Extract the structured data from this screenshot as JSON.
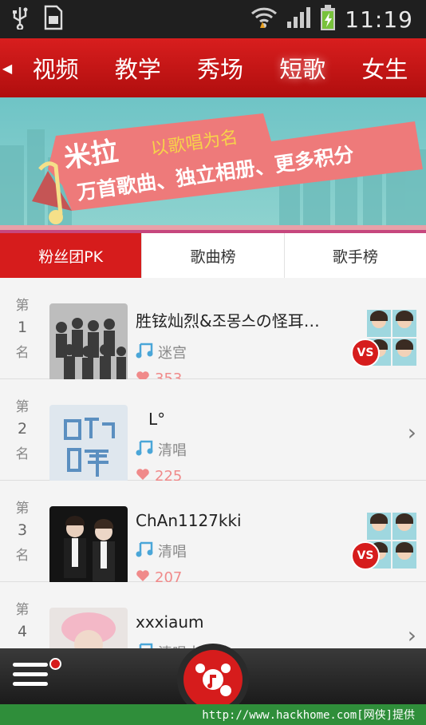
{
  "status_bar": {
    "time": "11:19"
  },
  "top_nav": {
    "tabs": [
      {
        "label": "视频"
      },
      {
        "label": "教学"
      },
      {
        "label": "秀场"
      },
      {
        "label": "短歌",
        "active": true
      },
      {
        "label": "女生"
      }
    ]
  },
  "banner": {
    "brand": "米拉",
    "tagline": "以歌唱为名",
    "slogan": "万首歌曲、独立相册、更多积分"
  },
  "segment_tabs": [
    {
      "label": "粉丝团PK",
      "active": true
    },
    {
      "label": "歌曲榜"
    },
    {
      "label": "歌手榜"
    }
  ],
  "rank_labels": {
    "prefix": "第",
    "suffix": "名"
  },
  "list": [
    {
      "rank": "1",
      "name": "胜铉灿烈&조몽스の怪耳…",
      "song": "迷宫",
      "likes": "353",
      "vs": "VS"
    },
    {
      "rank": "2",
      "name": "L°",
      "song": "清唱",
      "likes": "225"
    },
    {
      "rank": "3",
      "name": "ChAn1127kki",
      "song": "清唱",
      "likes": "207",
      "vs": "VS"
    },
    {
      "rank": "4",
      "name": "xxxiaum",
      "song": "清唱十分钟",
      "likes": ""
    }
  ],
  "footer": {
    "text": "http://www.hackhome.com[网侠]提供"
  },
  "colors": {
    "accent": "#d61c1c",
    "banner_bg": "#7ccac8",
    "footer_bg": "#2f8e3a"
  }
}
